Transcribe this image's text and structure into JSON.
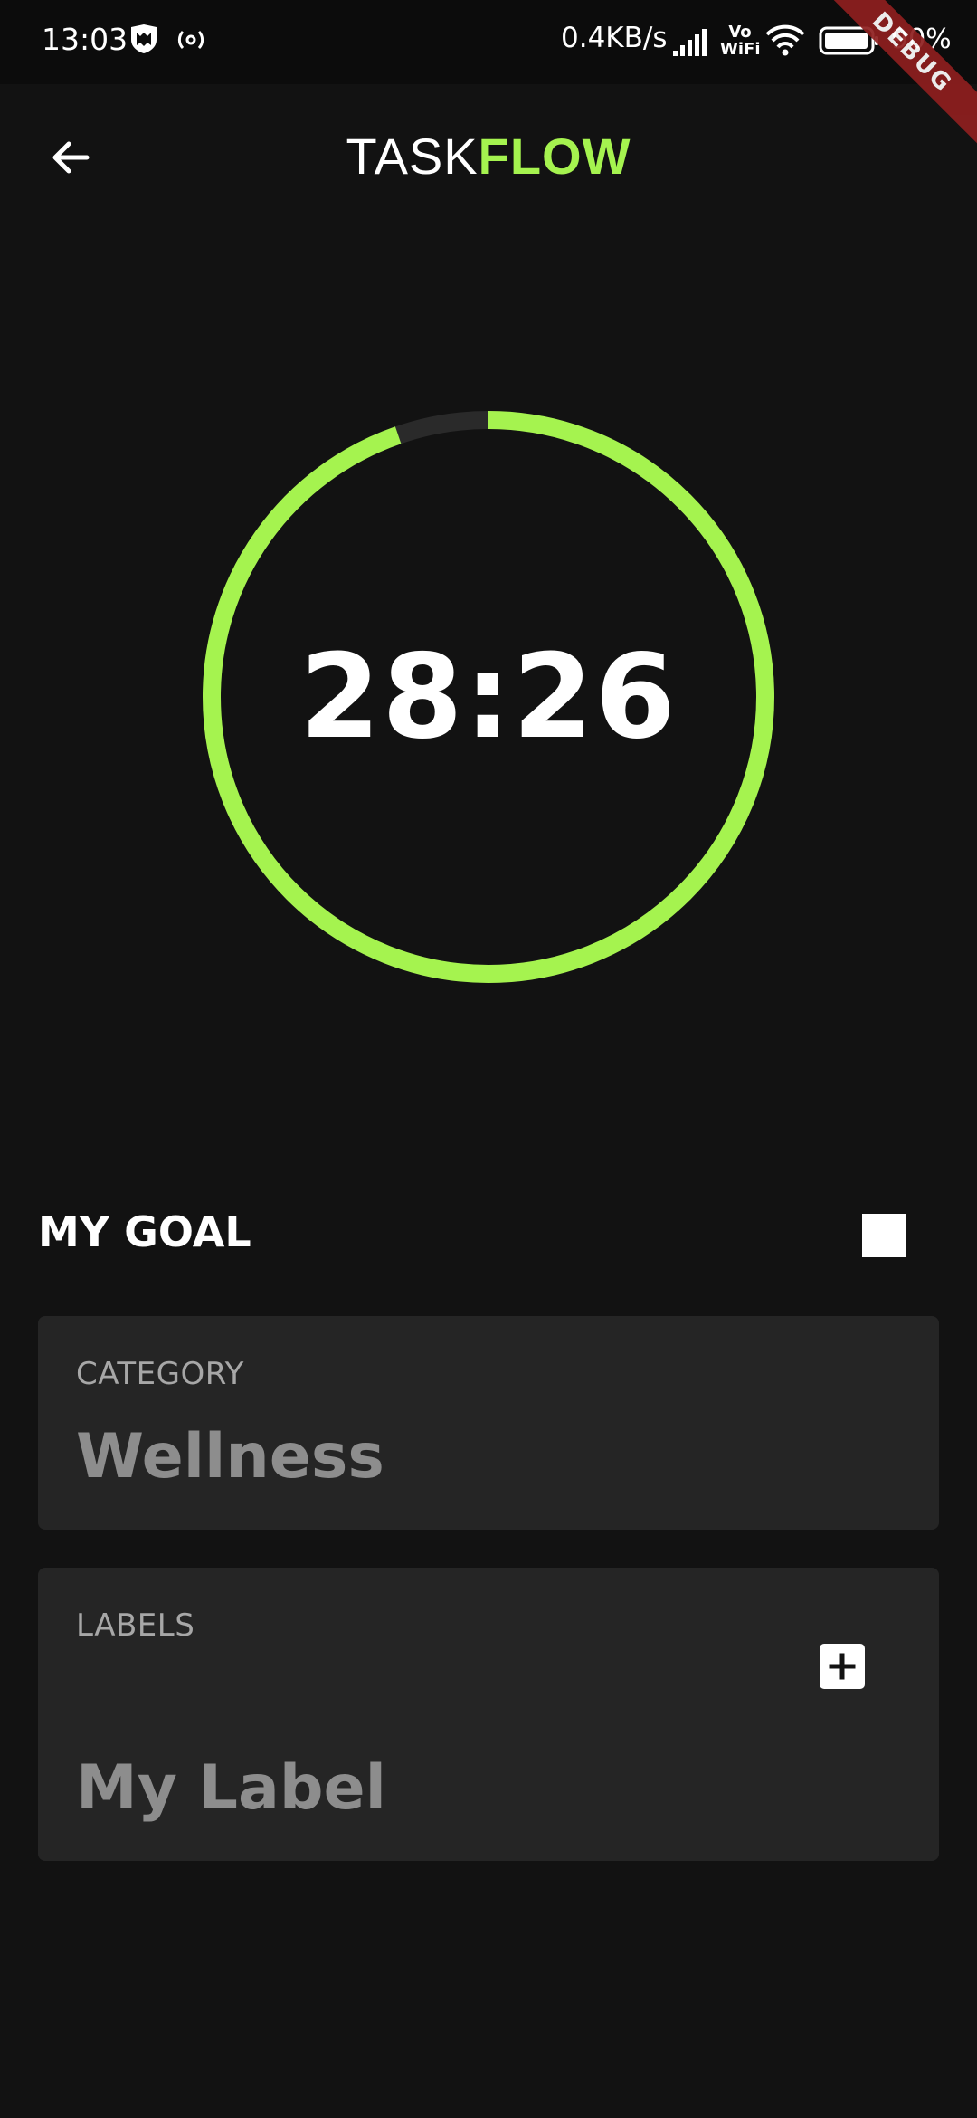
{
  "status_bar": {
    "time": "13:03",
    "network_speed": "0.4KB/s",
    "volte_top": "Vo",
    "volte_bottom": "WiFi",
    "battery_percent": "90%",
    "debug_banner": "DEBUG",
    "icons": [
      "mcafee-shield-icon",
      "hotspot-icon",
      "signal-icon",
      "wifi-icon",
      "battery-icon"
    ]
  },
  "header": {
    "title_part1": "TASK",
    "title_part2": "FLOW",
    "back_icon": "arrow-left-icon"
  },
  "timer": {
    "display": "28:26",
    "progress_fraction": 0.947
  },
  "goal": {
    "title": "MY GOAL",
    "checked": false
  },
  "category": {
    "caption": "CATEGORY",
    "value": "Wellness"
  },
  "labels": {
    "caption": "LABELS",
    "value": "My Label",
    "add_icon": "plus-icon"
  },
  "colors": {
    "accent": "#a5f34f",
    "background": "#121212",
    "card": "#252525",
    "ring_track": "#2a2a2a"
  }
}
